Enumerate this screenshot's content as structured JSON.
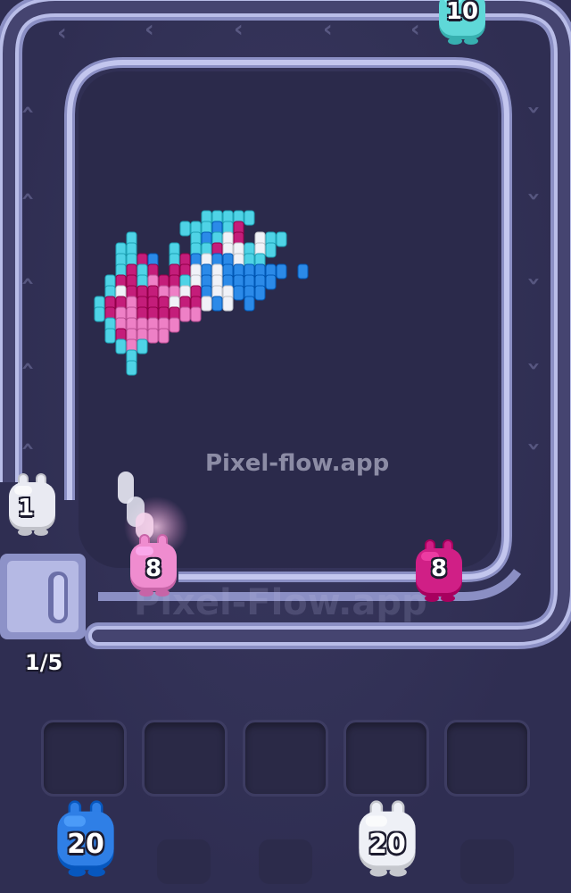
{
  "watermark": {
    "center_text": "Pixel-flow.app",
    "ghost_text": "Pixel-Flow.app"
  },
  "conveyor": {
    "counter": "1/5"
  },
  "creatures": {
    "top_cyan": {
      "number": "10",
      "color": "#5fd8d8"
    },
    "left_white": {
      "number": "1",
      "color": "#e9eaf2"
    },
    "pink_track": {
      "number": "8",
      "color": "#ef8ccf"
    },
    "magenta_track": {
      "number": "8",
      "color": "#d01f86"
    },
    "queue_blue": {
      "number": "20",
      "color": "#2f7fe6"
    },
    "queue_white": {
      "number": "20",
      "color": "#eef0f6"
    }
  },
  "slots_count": 5,
  "pixel_art_colors": {
    "cyan": "#4fd3e6",
    "magenta": "#c41d7a",
    "pink": "#ee80c6",
    "blue": "#2b8ae8",
    "white": "#f0f2f8"
  }
}
